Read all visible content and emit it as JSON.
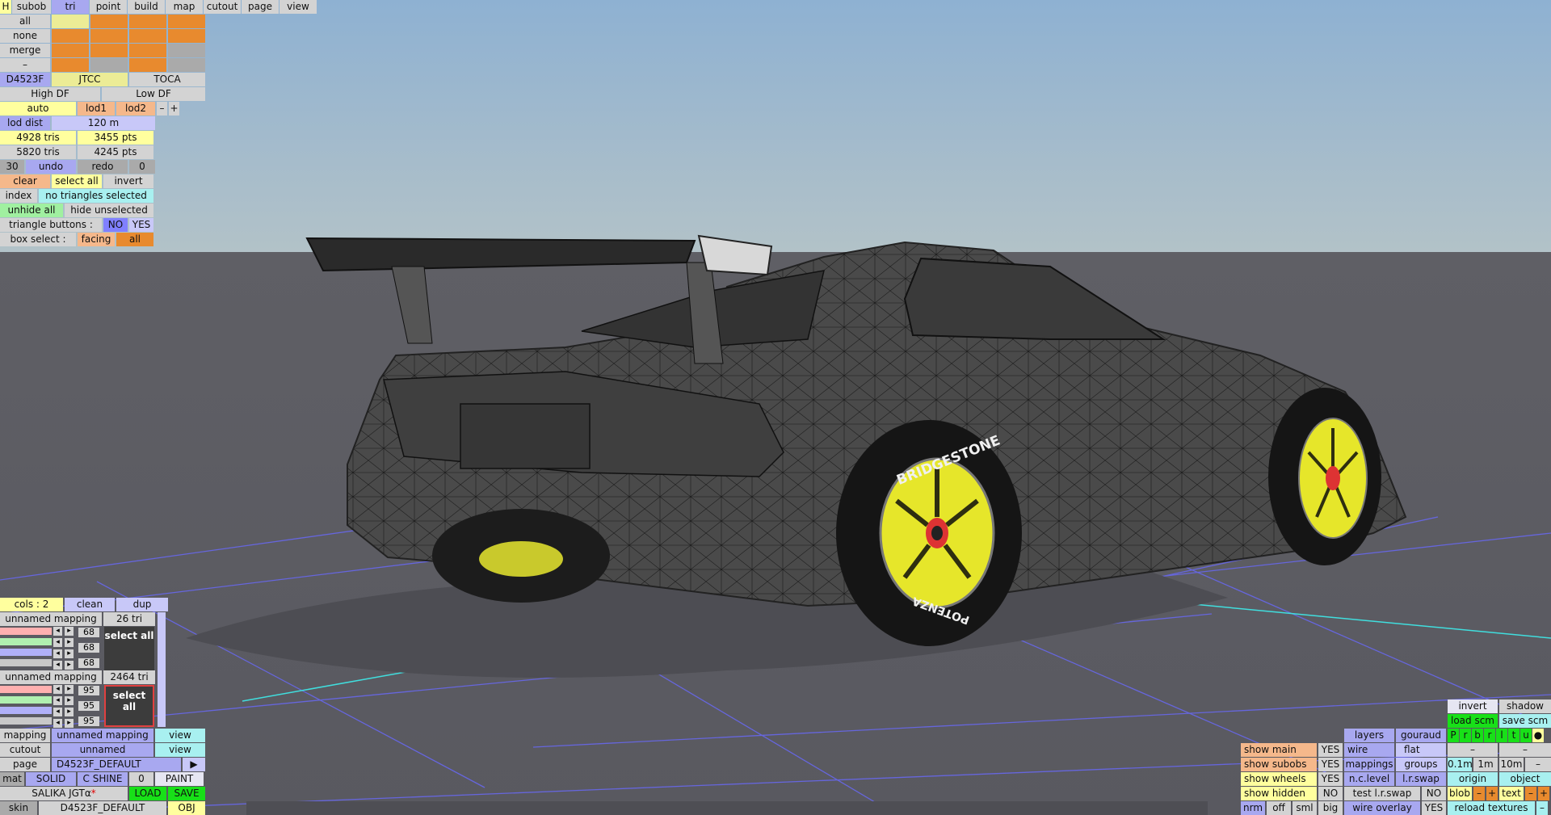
{
  "top_menu": {
    "h": "H",
    "subob": "subob",
    "tri": "tri",
    "point": "point",
    "build": "build",
    "map": "map",
    "cutout": "cutout",
    "page": "page",
    "view": "view"
  },
  "sel": {
    "all": "all",
    "none": "none",
    "merge": "merge",
    "dash": "–"
  },
  "config": {
    "name": "D4523F",
    "jtcc": "JTCC",
    "toca": "TOCA",
    "high_df": "High DF",
    "low_df": "Low DF"
  },
  "lod": {
    "auto": "auto",
    "lod1": "lod1",
    "lod2": "lod2",
    "minus": "–",
    "plus": "+",
    "dist_label": "lod dist",
    "dist_value": "120 m"
  },
  "stats": {
    "tris_a": "4928 tris",
    "pts_a": "3455 pts",
    "tris_b": "5820 tris",
    "pts_b": "4245 pts"
  },
  "history": {
    "count": "30",
    "undo": "undo",
    "redo": "redo",
    "redo_count": "0"
  },
  "selection": {
    "clear": "clear",
    "select_all": "select all",
    "invert": "invert",
    "index": "index",
    "status": "no triangles selected",
    "unhide_all": "unhide all",
    "hide_unselected": "hide unselected",
    "triangle_buttons": "triangle buttons :",
    "no": "NO",
    "yes": "YES",
    "box_select": "box select :",
    "facing": "facing",
    "all": "all"
  },
  "mapping_panel": {
    "cols": "cols : 2",
    "clean": "clean",
    "dup": "dup",
    "maps": [
      {
        "name": "unnamed mapping",
        "count": "26 tri",
        "values": [
          "68",
          "68",
          "68"
        ],
        "select_all": "select all"
      },
      {
        "name": "unnamed mapping",
        "count": "2464 tri",
        "values": [
          "95",
          "95",
          "95"
        ],
        "select_all": "select all"
      }
    ],
    "arrow_left": "◂",
    "arrow_right": "▸"
  },
  "bottom_left": {
    "mapping_label": "mapping",
    "mapping_value": "unnamed mapping",
    "view": "view",
    "cutout_label": "cutout",
    "cutout_value": "unnamed",
    "page_label": "page",
    "page_value": "D4523F_DEFAULT",
    "play": "▶",
    "mat": "mat",
    "solid": "SOLID",
    "cshine": "C SHINE",
    "zero": "0",
    "paint": "PAINT",
    "car_name": "SALIKA JGTα",
    "star": "*",
    "load": "LOAD",
    "save": "SAVE",
    "skin": "skin",
    "skin_value": "D4523F_DEFAULT",
    "obj": "OBJ"
  },
  "bottom_right": {
    "invert": "invert",
    "shadow": "shadow",
    "load_scm": "load scm",
    "save_scm": "save scm",
    "layers": "layers",
    "gouraud": "gouraud",
    "letters": [
      "P",
      "r",
      "b",
      "r",
      "l",
      "t",
      "u"
    ],
    "dot": "●",
    "show_main": "show main",
    "wire": "wire",
    "flat": "flat",
    "dash": "–",
    "show_subobs": "show subobs",
    "mappings": "mappings",
    "groups": "groups",
    "d01": "0.1m",
    "d1": "1m",
    "d10": "10m",
    "show_wheels": "show wheels",
    "nc_level": "n.c.level",
    "lr_swap": "l.r.swap",
    "origin": "origin",
    "object": "object",
    "show_hidden": "show hidden",
    "test_lr_swap": "test l.r.swap",
    "blob": "blob",
    "minus": "–",
    "plus": "+",
    "text": "text",
    "nrm": "nrm",
    "off": "off",
    "sml": "sml",
    "big": "big",
    "wire_overlay": "wire overlay",
    "reload_textures": "reload textures",
    "yes": "YES",
    "no": "NO"
  },
  "tire": {
    "brand": "BRIDGESTONE",
    "model": "POTENZA"
  },
  "colors": {
    "wheel": "#e6e62a",
    "body": "#4a4a4a",
    "sky": "#9bb7cf",
    "ground": "#5f5f65",
    "grid": "#6a6ad8",
    "axis": "#3ce0e0"
  }
}
